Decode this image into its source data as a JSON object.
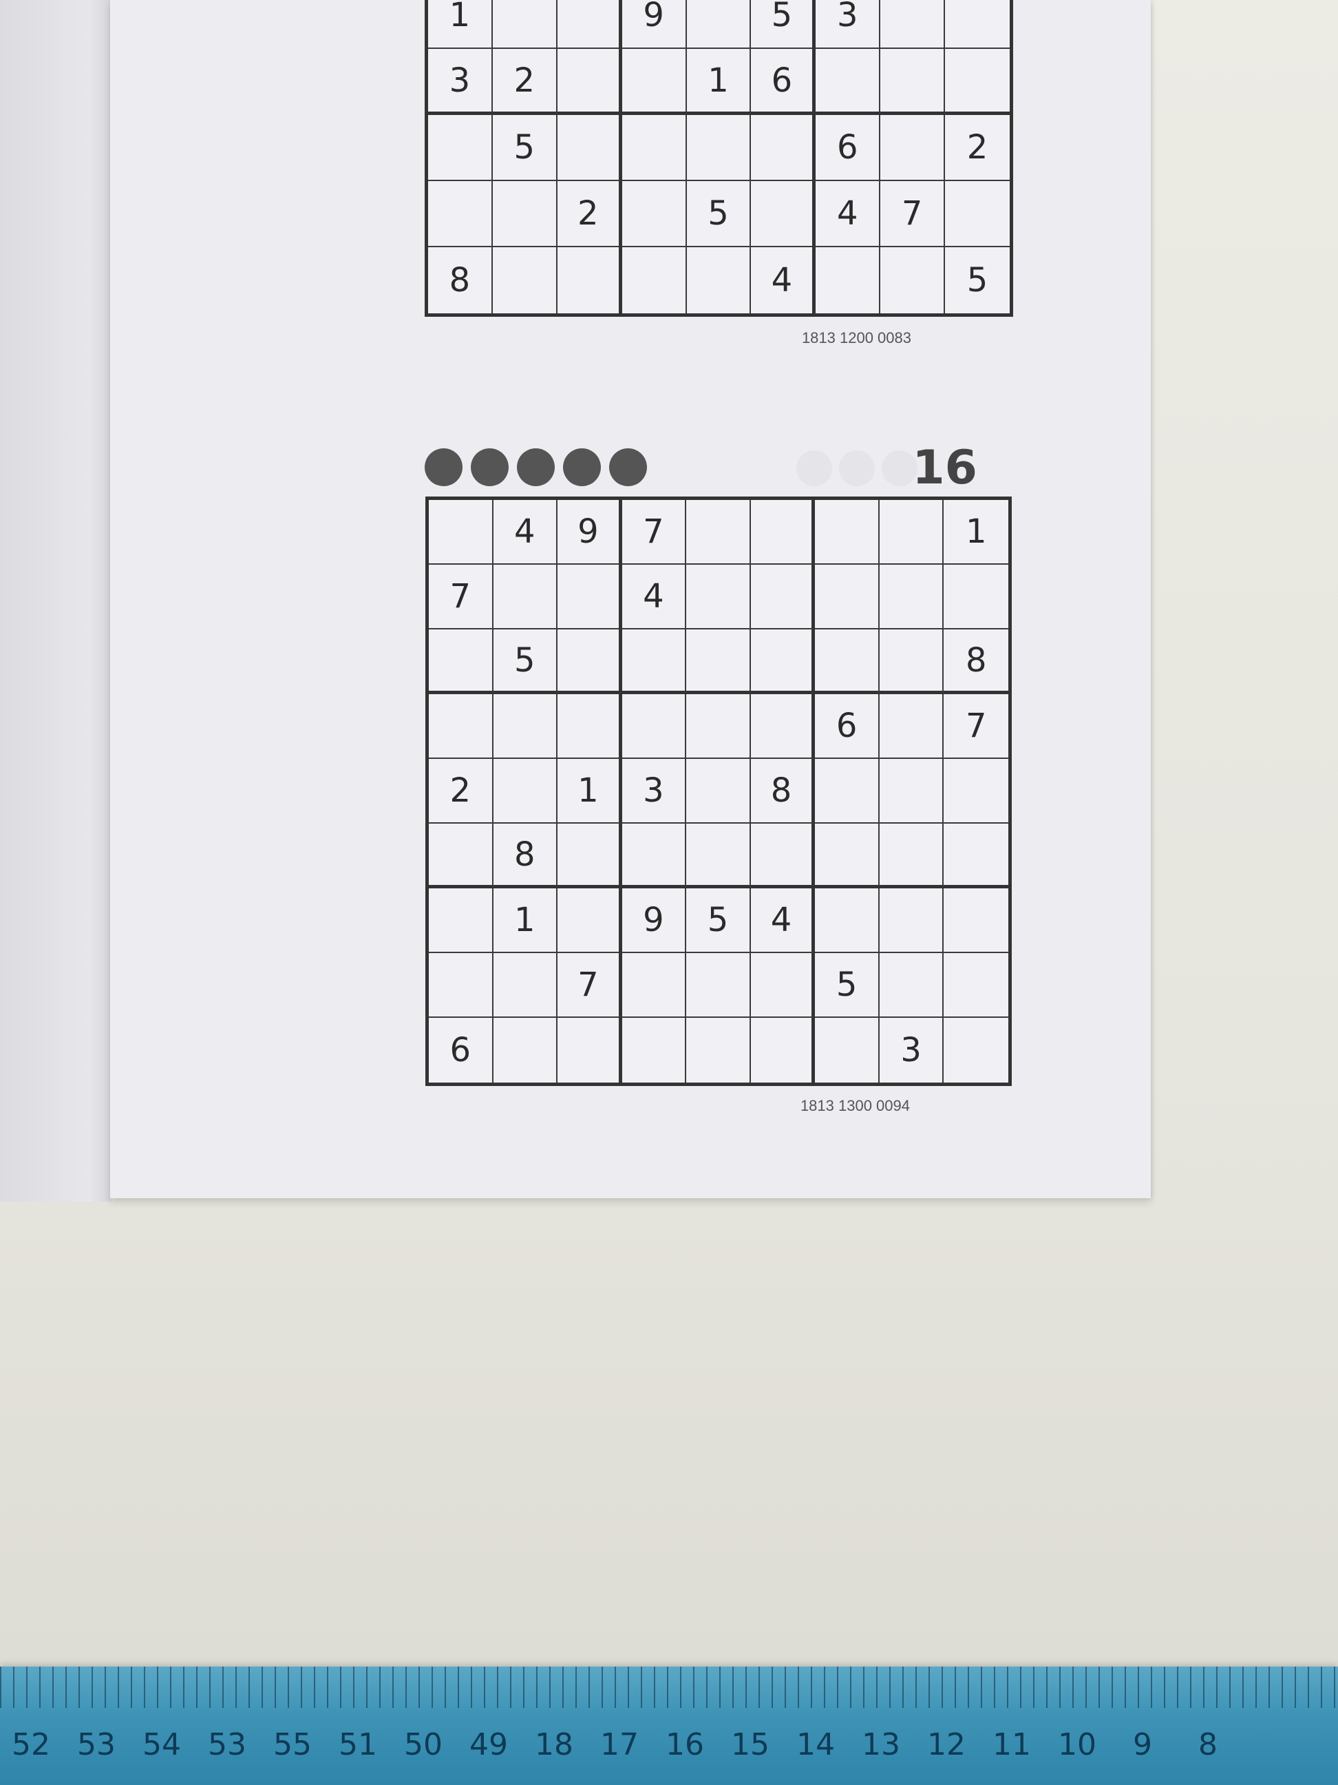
{
  "puzzle_top": {
    "grid": [
      [
        "1",
        "",
        "",
        "9",
        "",
        "5",
        "3",
        "",
        ""
      ],
      [
        "3",
        "2",
        "",
        "",
        "1",
        "6",
        "",
        "",
        ""
      ],
      [
        "",
        "5",
        "",
        "",
        "",
        "",
        "6",
        "",
        "2"
      ],
      [
        "",
        "",
        "2",
        "",
        "5",
        "",
        "4",
        "7",
        ""
      ],
      [
        "8",
        "",
        "",
        "",
        "",
        "4",
        "",
        "",
        "5"
      ]
    ],
    "code": "1813 1200 0083"
  },
  "puzzle_main": {
    "number": "16",
    "difficulty": 5,
    "grid": [
      [
        "",
        "4",
        "9",
        "7",
        "",
        "",
        "",
        "",
        "1"
      ],
      [
        "7",
        "",
        "",
        "4",
        "",
        "",
        "",
        "",
        ""
      ],
      [
        "",
        "5",
        "",
        "",
        "",
        "",
        "",
        "",
        "8"
      ],
      [
        "",
        "",
        "",
        "",
        "",
        "",
        "6",
        "",
        "7"
      ],
      [
        "2",
        "",
        "1",
        "3",
        "",
        "8",
        "",
        "",
        ""
      ],
      [
        "",
        "8",
        "",
        "",
        "",
        "",
        "",
        "",
        ""
      ],
      [
        "",
        "1",
        "",
        "9",
        "5",
        "4",
        "",
        "",
        ""
      ],
      [
        "",
        "",
        "7",
        "",
        "",
        "",
        "5",
        "",
        ""
      ],
      [
        "6",
        "",
        "",
        "",
        "",
        "",
        "",
        "3",
        ""
      ]
    ],
    "code": "1813 1300 0094"
  },
  "ruler": {
    "labels": [
      "52",
      "53",
      "54",
      "53",
      "55",
      "51",
      "50",
      "49",
      "18",
      "17",
      "16",
      "15",
      "14",
      "13",
      "12",
      "11",
      "10",
      "9",
      "8"
    ]
  }
}
